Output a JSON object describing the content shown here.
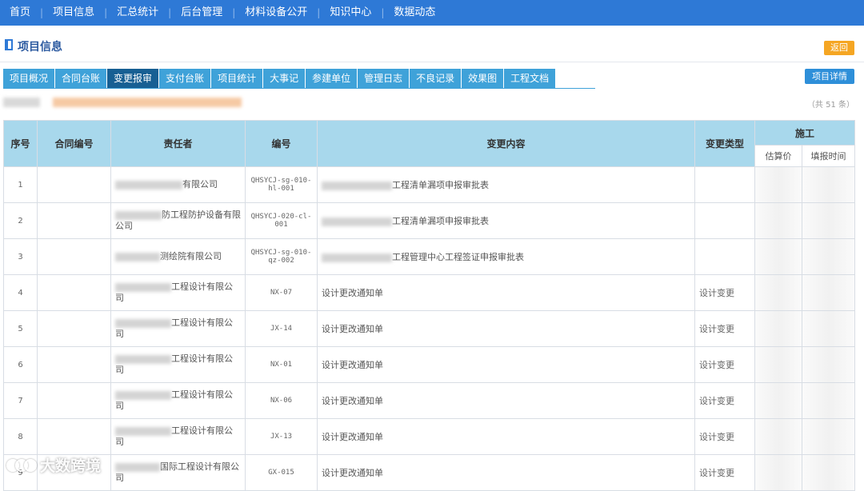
{
  "topnav": {
    "items": [
      "首页",
      "项目信息",
      "汇总统计",
      "后台管理",
      "材料设备公开",
      "知识中心",
      "数据动态"
    ]
  },
  "page": {
    "title": "项目信息",
    "back_label": "返回",
    "detail_label": "项目详情",
    "count_text": "（共 51 条）"
  },
  "tabs": {
    "items": [
      "项目概况",
      "合同台账",
      "变更报审",
      "支付台账",
      "项目统计",
      "大事记",
      "参建单位",
      "管理日志",
      "不良记录",
      "效果图",
      "工程文档"
    ],
    "active_index": 2
  },
  "table": {
    "headers": {
      "index": "序号",
      "contract_no": "合同编号",
      "responsible": "责任者",
      "code": "编号",
      "content": "变更内容",
      "change_type": "变更类型",
      "construction": "施工",
      "estimate": "估算价",
      "fill_time": "填报时间"
    },
    "rows": [
      {
        "index": "1",
        "responsible": "有限公司",
        "code": "QHSYCJ-sg-010-hl-001",
        "content": "工程清单漏项申报审批表",
        "type": ""
      },
      {
        "index": "2",
        "responsible": "防工程防护设备有限公司",
        "code": "QHSYCJ-020-cl-001",
        "content": "工程清单漏项申报审批表",
        "type": ""
      },
      {
        "index": "3",
        "responsible": "测绘院有限公司",
        "code": "QHSYCJ-sg-010-qz-002",
        "content": "工程管理中心工程签证申报审批表",
        "type": ""
      },
      {
        "index": "4",
        "responsible": "工程设计有限公司",
        "code": "NX-07",
        "content": "设计更改通知单",
        "type": "设计变更"
      },
      {
        "index": "5",
        "responsible": "工程设计有限公司",
        "code": "JX-14",
        "content": "设计更改通知单",
        "type": "设计变更"
      },
      {
        "index": "6",
        "responsible": "工程设计有限公司",
        "code": "NX-01",
        "content": "设计更改通知单",
        "type": "设计变更"
      },
      {
        "index": "7",
        "responsible": "工程设计有限公司",
        "code": "NX-06",
        "content": "设计更改通知单",
        "type": "设计变更"
      },
      {
        "index": "8",
        "responsible": "工程设计有限公司",
        "code": "JX-13",
        "content": "设计更改通知单",
        "type": "设计变更"
      },
      {
        "index": "9",
        "responsible": "国际工程设计有限公司",
        "code": "GX-015",
        "content": "设计更改通知单",
        "type": "设计变更"
      }
    ]
  },
  "watermark": {
    "text": "大数跨境"
  }
}
